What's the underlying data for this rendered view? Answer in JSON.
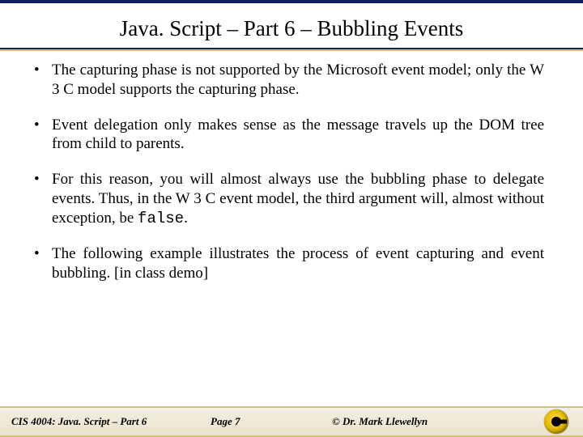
{
  "title": "Java. Script – Part 6 – Bubbling Events",
  "bullets": [
    {
      "text": "The capturing phase is not supported by the Microsoft event model; only the W 3 C model supports the capturing phase."
    },
    {
      "text": "Event delegation only makes sense as the message travels up the DOM tree from child to parents."
    },
    {
      "text_pre": "For this reason, you will almost always use the bubbling phase to delegate events.  Thus, in the W 3 C event model, the third argument will, almost without exception, be ",
      "code": "false",
      "text_post": "."
    },
    {
      "text": "The following example illustrates the process of event capturing and event bubbling.  [in class demo]"
    }
  ],
  "footer": {
    "left": "CIS 4004: Java. Script – Part 6",
    "mid": "Page 7",
    "right": "© Dr. Mark Llewellyn"
  }
}
